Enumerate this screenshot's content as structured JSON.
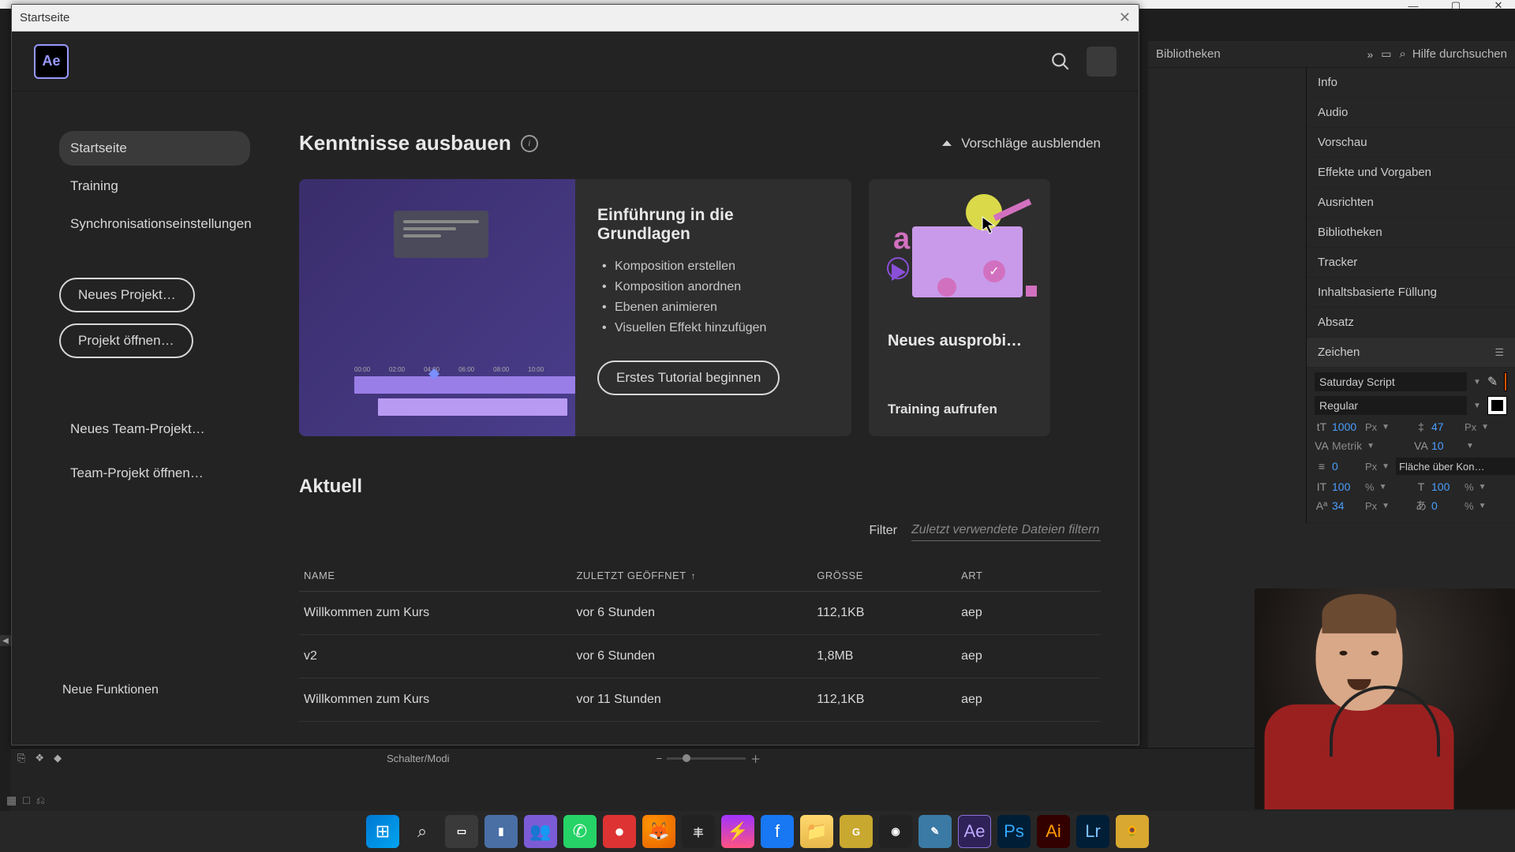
{
  "window": {
    "title": "Startseite"
  },
  "header": {
    "logo_text": "Ae"
  },
  "sidebar": {
    "items": [
      {
        "label": "Startseite",
        "active": true
      },
      {
        "label": "Training",
        "active": false
      },
      {
        "label": "Synchronisationseinstellungen",
        "active": false
      }
    ],
    "new_project": "Neues Projekt…",
    "open_project": "Projekt öffnen…",
    "new_team_project": "Neues Team-Projekt…",
    "open_team_project": "Team-Projekt öffnen…",
    "new_features": "Neue Funktionen"
  },
  "learn": {
    "section_title": "Kenntnisse ausbauen",
    "hide_suggestions": "Vorschläge ausblenden",
    "card_title": "Einführung in die Grundlagen",
    "bullets": [
      "Komposition erstellen",
      "Komposition anordnen",
      "Ebenen animieren",
      "Visuellen Effekt hinzufügen"
    ],
    "start_tutorial": "Erstes Tutorial beginnen",
    "small_card_title": "Neues ausprobi…",
    "small_card_link": "Training aufrufen",
    "timeline_nums": [
      "00:00",
      "02:00",
      "04:00",
      "06:00",
      "08:00",
      "10:00"
    ]
  },
  "recent": {
    "section_title": "Aktuell",
    "filter_label": "Filter",
    "filter_placeholder": "Zuletzt verwendete Dateien filtern",
    "columns": {
      "name": "NAME",
      "opened": "ZULETZT GEÖFFNET",
      "size": "GRÖSSE",
      "kind": "ART"
    },
    "rows": [
      {
        "name": "Willkommen zum Kurs",
        "opened": "vor 6 Stunden",
        "size": "112,1KB",
        "kind": "aep"
      },
      {
        "name": "v2",
        "opened": "vor 6 Stunden",
        "size": "1,8MB",
        "kind": "aep"
      },
      {
        "name": "Willkommen zum Kurs",
        "opened": "vor 11 Stunden",
        "size": "112,1KB",
        "kind": "aep"
      }
    ]
  },
  "right_panels": {
    "tab_label": "Bibliotheken",
    "help_search": "Hilfe durchsuchen",
    "rows": [
      "Info",
      "Audio",
      "Vorschau",
      "Effekte und Vorgaben",
      "Ausrichten",
      "Bibliotheken",
      "Tracker",
      "Inhaltsbasierte Füllung",
      "Absatz",
      "Zeichen"
    ],
    "character": {
      "font": "Saturday Script",
      "style": "Regular",
      "size": "1000",
      "size_unit": "Px",
      "leading": "47",
      "leading_unit": "Px",
      "kerning": "Metrik",
      "tracking": "10",
      "stroke": "0",
      "stroke_unit": "Px",
      "fill_label": "Fläche über Kon…",
      "hscale": "100",
      "hscale_unit": "%",
      "vscale": "100",
      "vscale_unit": "%",
      "baseline": "34",
      "baseline_unit": "Px",
      "tsume": "0",
      "tsume_unit": "%"
    }
  },
  "timeline_footer": {
    "label": "Schalter/Modi"
  },
  "colors": {
    "accent_blue": "#4a9eff",
    "ae_purple": "#9999ff",
    "swatch": "#ff5500"
  }
}
